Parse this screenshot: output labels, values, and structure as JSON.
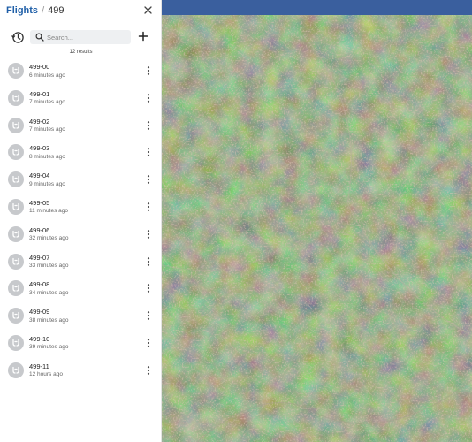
{
  "header": {
    "breadcrumb_root": "Flights",
    "separator": "/",
    "breadcrumb_current": "499"
  },
  "toolbar": {
    "search_placeholder": "Search...",
    "history_icon": "history-clock-icon",
    "add_icon": "plus-icon"
  },
  "results_label": "12 results",
  "flights": [
    {
      "name": "499-00",
      "time": "6 minutes ago"
    },
    {
      "name": "499-01",
      "time": "7 minutes ago"
    },
    {
      "name": "499-02",
      "time": "7 minutes ago"
    },
    {
      "name": "499-03",
      "time": "8 minutes ago"
    },
    {
      "name": "499-04",
      "time": "9 minutes ago"
    },
    {
      "name": "499-05",
      "time": "11 minutes ago"
    },
    {
      "name": "499-06",
      "time": "32 minutes ago"
    },
    {
      "name": "499-07",
      "time": "33 minutes ago"
    },
    {
      "name": "499-08",
      "time": "34 minutes ago"
    },
    {
      "name": "499-09",
      "time": "38 minutes ago"
    },
    {
      "name": "499-10",
      "time": "39 minutes ago"
    },
    {
      "name": "499-11",
      "time": "12 hours ago"
    }
  ],
  "colors": {
    "accent": "#1f5fa8",
    "avatar": "#c7c9cc",
    "map_top_band": "#3a5f9e"
  }
}
